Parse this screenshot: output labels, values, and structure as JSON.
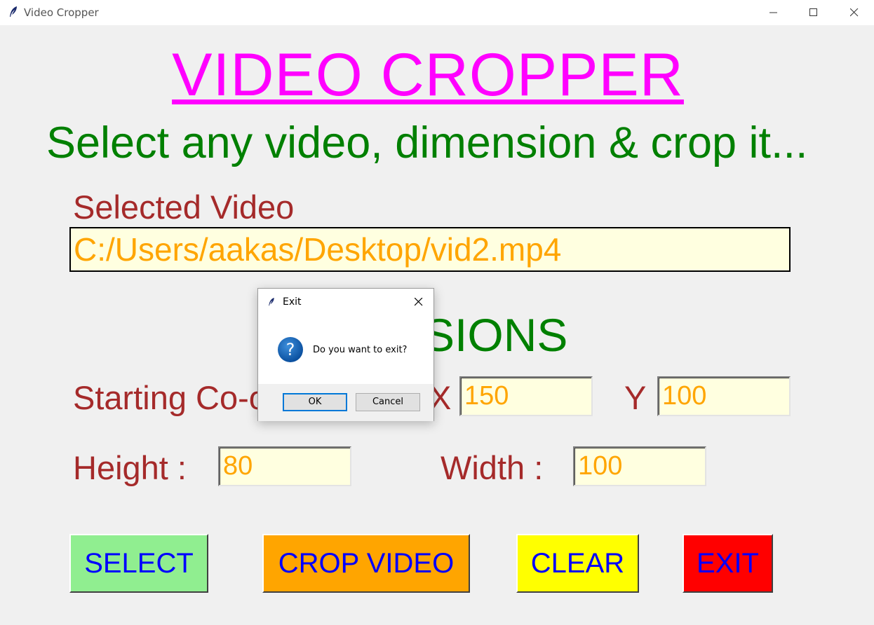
{
  "window": {
    "title": "Video Cropper",
    "controls": [
      "minimize-icon",
      "maximize-icon",
      "close-icon"
    ]
  },
  "app": {
    "heading": "VIDEO  CROPPER",
    "subheading": "Select any video, dimension & crop it...",
    "selected_video_label": "Selected Video",
    "selected_video_path": "C:/Users/aakas/Desktop/vid2.mp4",
    "dimensions_heading_partial": "SIONS",
    "starting_coords_label_partial": "Starting Co-o",
    "x_label": "X",
    "x_value": "150",
    "y_label": "Y",
    "y_value": "100",
    "height_label": "Height  :",
    "height_value": "80",
    "width_label": "Width  :",
    "width_value": "100"
  },
  "buttons": {
    "select": "SELECT",
    "crop": "CROP VIDEO",
    "clear": "CLEAR",
    "exit": "EXIT"
  },
  "dialog": {
    "title": "Exit",
    "message": "Do you want to exit?",
    "icon": "question-icon",
    "ok": "OK",
    "cancel": "Cancel"
  },
  "colors": {
    "heading": "#ff00ff",
    "subheading": "#008000",
    "labels": "#a52a2a",
    "values": "#ffa500",
    "button_text": "#0000ff",
    "select_bg": "#90ee90",
    "crop_bg": "#ffa500",
    "clear_bg": "#ffff00",
    "exit_bg": "#ff0000"
  }
}
